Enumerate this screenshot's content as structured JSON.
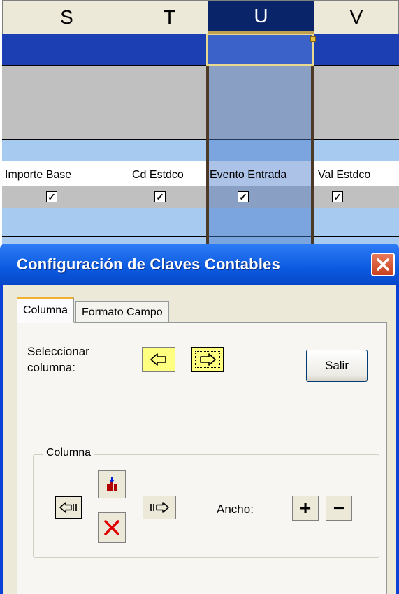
{
  "sheet": {
    "columns": [
      "S",
      "T",
      "U",
      "V"
    ],
    "selected_column": "U",
    "fields": [
      {
        "label": "Importe Base",
        "checked": true
      },
      {
        "label": "Cd Estdco",
        "checked": true
      },
      {
        "label": "Evento Entrada",
        "checked": true
      },
      {
        "label": "Val Estdco",
        "checked": true
      }
    ],
    "check_mark": "✓"
  },
  "dialog": {
    "title": "Configuración de Claves Contables",
    "tabs": [
      "Columna",
      "Formato Campo"
    ],
    "active_tab": "Columna",
    "select_column_label_line1": "Seleccionar",
    "select_column_label_line2": "columna:",
    "exit_button": "Salir",
    "group_title": "Columna",
    "width_label": "Ancho:",
    "plus_label": "+",
    "minus_label": "−"
  },
  "icons": {
    "close": "close-icon",
    "left_arrow": "arrow-left-icon",
    "right_arrow": "arrow-right-icon",
    "move_left": "move-column-left-icon",
    "move_right": "move-column-right-icon",
    "insert": "insert-column-icon",
    "delete": "delete-column-icon"
  },
  "colors": {
    "header_selected": "#0a246a",
    "title_bar": "#0a5ae0",
    "dialog_face": "#ece9d8",
    "highlight_yellow": "#ffff80",
    "delete_red": "#e00000"
  }
}
